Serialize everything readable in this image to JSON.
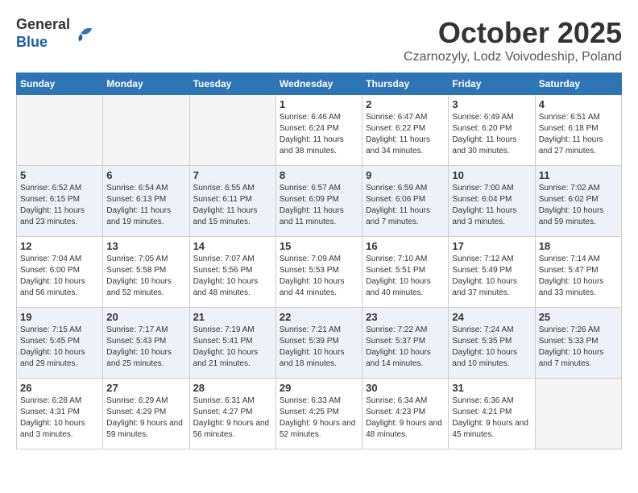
{
  "logo": {
    "general": "General",
    "blue": "Blue"
  },
  "header": {
    "month": "October 2025",
    "location": "Czarnozyly, Lodz Voivodeship, Poland"
  },
  "weekdays": [
    "Sunday",
    "Monday",
    "Tuesday",
    "Wednesday",
    "Thursday",
    "Friday",
    "Saturday"
  ],
  "weeks": [
    [
      {
        "day": "",
        "sunrise": "",
        "sunset": "",
        "daylight": ""
      },
      {
        "day": "",
        "sunrise": "",
        "sunset": "",
        "daylight": ""
      },
      {
        "day": "",
        "sunrise": "",
        "sunset": "",
        "daylight": ""
      },
      {
        "day": "1",
        "sunrise": "Sunrise: 6:46 AM",
        "sunset": "Sunset: 6:24 PM",
        "daylight": "Daylight: 11 hours and 38 minutes."
      },
      {
        "day": "2",
        "sunrise": "Sunrise: 6:47 AM",
        "sunset": "Sunset: 6:22 PM",
        "daylight": "Daylight: 11 hours and 34 minutes."
      },
      {
        "day": "3",
        "sunrise": "Sunrise: 6:49 AM",
        "sunset": "Sunset: 6:20 PM",
        "daylight": "Daylight: 11 hours and 30 minutes."
      },
      {
        "day": "4",
        "sunrise": "Sunrise: 6:51 AM",
        "sunset": "Sunset: 6:18 PM",
        "daylight": "Daylight: 11 hours and 27 minutes."
      }
    ],
    [
      {
        "day": "5",
        "sunrise": "Sunrise: 6:52 AM",
        "sunset": "Sunset: 6:15 PM",
        "daylight": "Daylight: 11 hours and 23 minutes."
      },
      {
        "day": "6",
        "sunrise": "Sunrise: 6:54 AM",
        "sunset": "Sunset: 6:13 PM",
        "daylight": "Daylight: 11 hours and 19 minutes."
      },
      {
        "day": "7",
        "sunrise": "Sunrise: 6:55 AM",
        "sunset": "Sunset: 6:11 PM",
        "daylight": "Daylight: 11 hours and 15 minutes."
      },
      {
        "day": "8",
        "sunrise": "Sunrise: 6:57 AM",
        "sunset": "Sunset: 6:09 PM",
        "daylight": "Daylight: 11 hours and 11 minutes."
      },
      {
        "day": "9",
        "sunrise": "Sunrise: 6:59 AM",
        "sunset": "Sunset: 6:06 PM",
        "daylight": "Daylight: 11 hours and 7 minutes."
      },
      {
        "day": "10",
        "sunrise": "Sunrise: 7:00 AM",
        "sunset": "Sunset: 6:04 PM",
        "daylight": "Daylight: 11 hours and 3 minutes."
      },
      {
        "day": "11",
        "sunrise": "Sunrise: 7:02 AM",
        "sunset": "Sunset: 6:02 PM",
        "daylight": "Daylight: 10 hours and 59 minutes."
      }
    ],
    [
      {
        "day": "12",
        "sunrise": "Sunrise: 7:04 AM",
        "sunset": "Sunset: 6:00 PM",
        "daylight": "Daylight: 10 hours and 56 minutes."
      },
      {
        "day": "13",
        "sunrise": "Sunrise: 7:05 AM",
        "sunset": "Sunset: 5:58 PM",
        "daylight": "Daylight: 10 hours and 52 minutes."
      },
      {
        "day": "14",
        "sunrise": "Sunrise: 7:07 AM",
        "sunset": "Sunset: 5:56 PM",
        "daylight": "Daylight: 10 hours and 48 minutes."
      },
      {
        "day": "15",
        "sunrise": "Sunrise: 7:09 AM",
        "sunset": "Sunset: 5:53 PM",
        "daylight": "Daylight: 10 hours and 44 minutes."
      },
      {
        "day": "16",
        "sunrise": "Sunrise: 7:10 AM",
        "sunset": "Sunset: 5:51 PM",
        "daylight": "Daylight: 10 hours and 40 minutes."
      },
      {
        "day": "17",
        "sunrise": "Sunrise: 7:12 AM",
        "sunset": "Sunset: 5:49 PM",
        "daylight": "Daylight: 10 hours and 37 minutes."
      },
      {
        "day": "18",
        "sunrise": "Sunrise: 7:14 AM",
        "sunset": "Sunset: 5:47 PM",
        "daylight": "Daylight: 10 hours and 33 minutes."
      }
    ],
    [
      {
        "day": "19",
        "sunrise": "Sunrise: 7:15 AM",
        "sunset": "Sunset: 5:45 PM",
        "daylight": "Daylight: 10 hours and 29 minutes."
      },
      {
        "day": "20",
        "sunrise": "Sunrise: 7:17 AM",
        "sunset": "Sunset: 5:43 PM",
        "daylight": "Daylight: 10 hours and 25 minutes."
      },
      {
        "day": "21",
        "sunrise": "Sunrise: 7:19 AM",
        "sunset": "Sunset: 5:41 PM",
        "daylight": "Daylight: 10 hours and 21 minutes."
      },
      {
        "day": "22",
        "sunrise": "Sunrise: 7:21 AM",
        "sunset": "Sunset: 5:39 PM",
        "daylight": "Daylight: 10 hours and 18 minutes."
      },
      {
        "day": "23",
        "sunrise": "Sunrise: 7:22 AM",
        "sunset": "Sunset: 5:37 PM",
        "daylight": "Daylight: 10 hours and 14 minutes."
      },
      {
        "day": "24",
        "sunrise": "Sunrise: 7:24 AM",
        "sunset": "Sunset: 5:35 PM",
        "daylight": "Daylight: 10 hours and 10 minutes."
      },
      {
        "day": "25",
        "sunrise": "Sunrise: 7:26 AM",
        "sunset": "Sunset: 5:33 PM",
        "daylight": "Daylight: 10 hours and 7 minutes."
      }
    ],
    [
      {
        "day": "26",
        "sunrise": "Sunrise: 6:28 AM",
        "sunset": "Sunset: 4:31 PM",
        "daylight": "Daylight: 10 hours and 3 minutes."
      },
      {
        "day": "27",
        "sunrise": "Sunrise: 6:29 AM",
        "sunset": "Sunset: 4:29 PM",
        "daylight": "Daylight: 9 hours and 59 minutes."
      },
      {
        "day": "28",
        "sunrise": "Sunrise: 6:31 AM",
        "sunset": "Sunset: 4:27 PM",
        "daylight": "Daylight: 9 hours and 56 minutes."
      },
      {
        "day": "29",
        "sunrise": "Sunrise: 6:33 AM",
        "sunset": "Sunset: 4:25 PM",
        "daylight": "Daylight: 9 hours and 52 minutes."
      },
      {
        "day": "30",
        "sunrise": "Sunrise: 6:34 AM",
        "sunset": "Sunset: 4:23 PM",
        "daylight": "Daylight: 9 hours and 48 minutes."
      },
      {
        "day": "31",
        "sunrise": "Sunrise: 6:36 AM",
        "sunset": "Sunset: 4:21 PM",
        "daylight": "Daylight: 9 hours and 45 minutes."
      },
      {
        "day": "",
        "sunrise": "",
        "sunset": "",
        "daylight": ""
      }
    ]
  ]
}
